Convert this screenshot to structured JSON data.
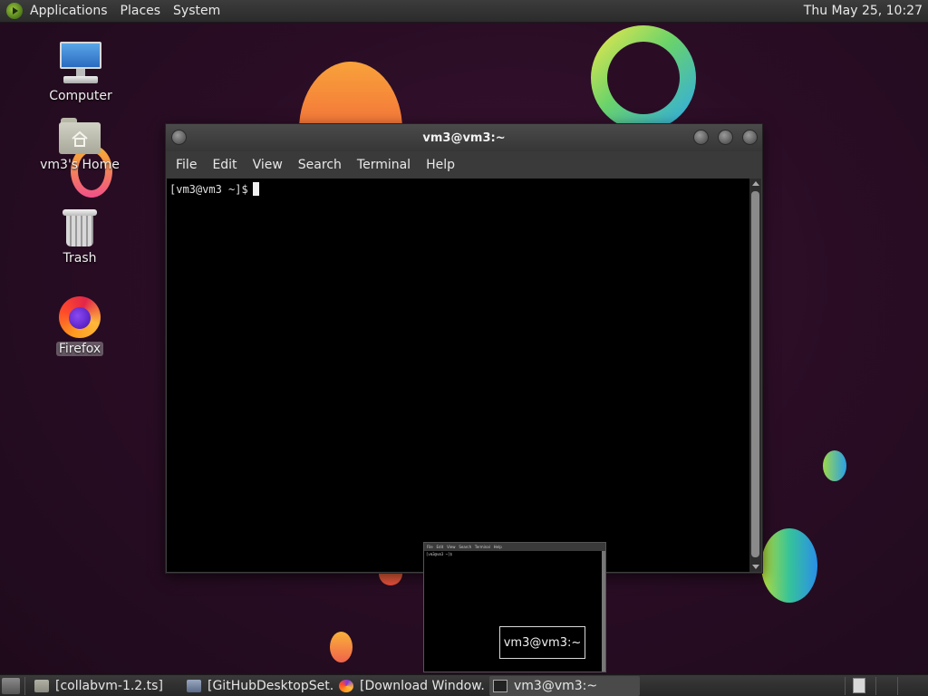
{
  "top_panel": {
    "menus": [
      "Applications",
      "Places",
      "System"
    ],
    "clock": "Thu May 25, 10:27"
  },
  "desktop_icons": {
    "computer": {
      "label": "Computer",
      "icon": "computer-icon"
    },
    "home": {
      "label": "vm3's Home",
      "icon": "home-folder-icon"
    },
    "trash": {
      "label": "Trash",
      "icon": "trash-icon"
    },
    "firefox": {
      "label": "Firefox",
      "icon": "firefox-icon"
    }
  },
  "terminal": {
    "title": "vm3@vm3:~",
    "menu": [
      "File",
      "Edit",
      "View",
      "Search",
      "Terminal",
      "Help"
    ],
    "prompt": "[vm3@vm3 ~]$"
  },
  "preview": {
    "tooltip": "vm3@vm3:~"
  },
  "taskbar": {
    "tasks": [
      {
        "label": "[collabvm-1.2.ts]",
        "icon": "folder-icon"
      },
      {
        "label": "[GitHubDesktopSet...",
        "icon": "installer-icon"
      },
      {
        "label": "[Download Window...",
        "icon": "firefox-icon"
      },
      {
        "label": "vm3@vm3:~",
        "icon": "terminal-icon",
        "active": true
      }
    ]
  },
  "colors": {
    "wallpaper": "#2a0d25",
    "panel": "#2b2b2b",
    "terminal_bg": "#000000"
  }
}
